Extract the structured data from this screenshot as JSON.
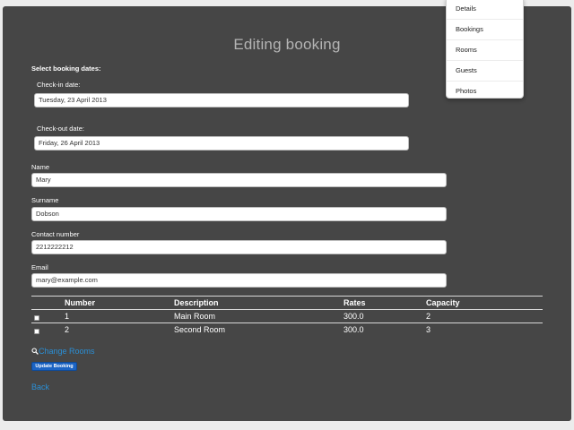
{
  "page": {
    "title": "Editing booking",
    "select_dates_label": "Select booking dates:"
  },
  "form": {
    "checkin": {
      "label": "Check-in date:",
      "value": "Tuesday, 23 April 2013"
    },
    "checkout": {
      "label": "Check-out date:",
      "value": "Friday, 26 April 2013"
    },
    "name": {
      "label": "Name",
      "value": "Mary"
    },
    "surname": {
      "label": "Surname",
      "value": "Dobson"
    },
    "contact": {
      "label": "Contact number",
      "value": "2212222212"
    },
    "email": {
      "label": "Email",
      "value": "mary@example.com"
    }
  },
  "rooms_table": {
    "headers": [
      "Number",
      "Description",
      "Rates",
      "Capacity"
    ],
    "rows": [
      {
        "number": "1",
        "description": "Main Room",
        "rate": "300.0",
        "capacity": "2",
        "checked": false
      },
      {
        "number": "2",
        "description": "Second Room",
        "rate": "300.0",
        "capacity": "3",
        "checked": false
      }
    ]
  },
  "actions": {
    "change_rooms": "Change Rooms",
    "update_booking": "Update Booking",
    "back": "Back"
  },
  "dropdown": {
    "items": [
      "Details",
      "Bookings",
      "Rooms",
      "Guests",
      "Photos"
    ]
  },
  "icons": {
    "change_rooms": "search-icon"
  },
  "colors": {
    "background": "#ececec",
    "panel": "#464646",
    "title": "#b4b4b4",
    "link": "#2a8fd6",
    "button": "#1c64c4"
  }
}
